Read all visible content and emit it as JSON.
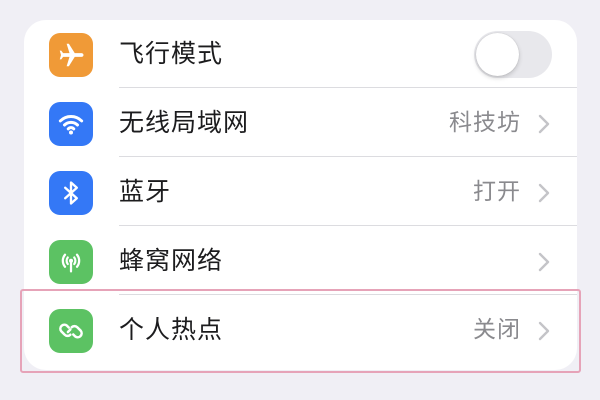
{
  "settings": {
    "items": [
      {
        "label": "飞行模式",
        "value": "",
        "icon": "airplane-icon",
        "icon_color": "#f09a37",
        "control": "toggle",
        "toggle_on": false
      },
      {
        "label": "无线局域网",
        "value": "科技坊",
        "icon": "wifi-icon",
        "icon_color": "#3478f6",
        "control": "chevron"
      },
      {
        "label": "蓝牙",
        "value": "打开",
        "icon": "bluetooth-icon",
        "icon_color": "#3478f6",
        "control": "chevron"
      },
      {
        "label": "蜂窝网络",
        "value": "",
        "icon": "cellular-icon",
        "icon_color": "#5cc263",
        "control": "chevron"
      },
      {
        "label": "个人热点",
        "value": "关闭",
        "icon": "hotspot-icon",
        "icon_color": "#5cc263",
        "control": "chevron",
        "highlighted": true
      }
    ]
  },
  "colors": {
    "background": "#f0eff5",
    "highlight_border": "#e6a3b8"
  }
}
